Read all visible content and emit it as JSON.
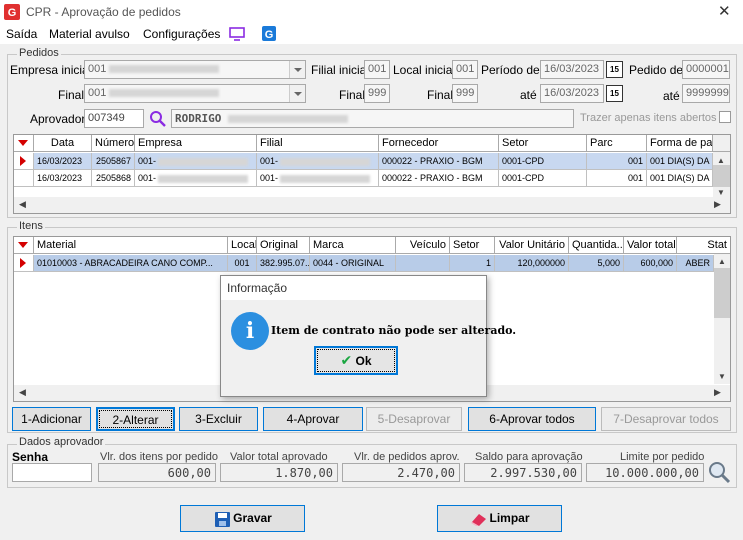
{
  "window": {
    "title": "CPR - Aprovação de pedidos"
  },
  "menu": {
    "items": [
      "Saída",
      "Material avulso",
      "Configurações"
    ]
  },
  "pedidos": {
    "group_label": "Pedidos",
    "empresa_inicial_label": "Empresa inicial",
    "empresa_inicial_value": "001",
    "final_label": "Final",
    "empresa_final_value": "001",
    "filial_inicial_label": "Filial inicial",
    "filial_inicial_value": "001",
    "filial_final_label": "Final",
    "filial_final_value": "999",
    "local_inicial_label": "Local inicial",
    "local_inicial_value": "001",
    "local_final_label": "Final",
    "local_final_value": "999",
    "periodo_label": "Período de",
    "periodo_de": "16/03/2023",
    "ate_label": "até",
    "periodo_ate": "16/03/2023",
    "pedido_de_label": "Pedido de",
    "pedido_de_value": "0000001",
    "pedido_ate_label": "até",
    "pedido_ate_value": "9999999",
    "aprovador_label": "Aprovador",
    "aprovador_code": "007349",
    "aprovador_name": "RODRIGO",
    "trazer_label": "Trazer apenas itens abertos"
  },
  "orders_grid": {
    "columns": [
      "Data",
      "Número",
      "Empresa",
      "Filial",
      "Fornecedor",
      "Setor",
      "Parc",
      "Forma de paga"
    ],
    "rows": [
      {
        "data": "16/03/2023",
        "numero": "2505867",
        "empresa": "001-",
        "filial": "001-",
        "fornecedor": "000022 - PRAXIO - BGM",
        "setor": "0001-CPD",
        "parc": "001",
        "forma": "001 DIA(S) DA"
      },
      {
        "data": "16/03/2023",
        "numero": "2505868",
        "empresa": "001-",
        "filial": "001-",
        "fornecedor": "000022 - PRAXIO - BGM",
        "setor": "0001-CPD",
        "parc": "001",
        "forma": "001 DIA(S) DA"
      }
    ]
  },
  "itens": {
    "group_label": "Itens",
    "columns": [
      "Material",
      "Local",
      "Original",
      "Marca",
      "Veículo",
      "Setor",
      "Valor Unitário",
      "Quantida...",
      "Valor total",
      "Stat"
    ],
    "rows": [
      {
        "material": "01010003 - ABRACADEIRA CANO COMP...",
        "local": "001",
        "original": "382.995.07...",
        "marca": "0044 - ORIGINAL",
        "veiculo": "",
        "setor": "1",
        "valor_unit": "120,000000",
        "quantidade": "5,000",
        "valor_total": "600,000",
        "stat": "ABER"
      }
    ]
  },
  "buttons": {
    "adicionar": "1-Adicionar",
    "alterar": "2-Alterar",
    "excluir": "3-Excluir",
    "aprovar": "4-Aprovar",
    "desaprovar": "5-Desaprovar",
    "aprovar_todos": "6-Aprovar todos",
    "desaprovar_todos": "7-Desaprovar todos"
  },
  "dados": {
    "group_label": "Dados aprovador",
    "senha_label": "Senha",
    "vlr_itens_label": "Vlr. dos itens por pedido",
    "vlr_itens_value": "600,00",
    "valor_total_label": "Valor total aprovado",
    "valor_total_value": "1.870,00",
    "vlr_pedidos_label": "Vlr. de pedidos aprov.",
    "vlr_pedidos_value": "2.470,00",
    "saldo_label": "Saldo para aprovação",
    "saldo_value": "2.997.530,00",
    "limite_label": "Limite por pedido",
    "limite_value": "10.000.000,00"
  },
  "footer": {
    "gravar": "Gravar",
    "limpar": "Limpar"
  },
  "dialog": {
    "title": "Informação",
    "message": "Item de contrato não pode ser alterado.",
    "ok": "Ok"
  },
  "colors": {
    "selection": "#c8d8f0",
    "accent": "#0078d7",
    "indicator": "#d40000"
  }
}
